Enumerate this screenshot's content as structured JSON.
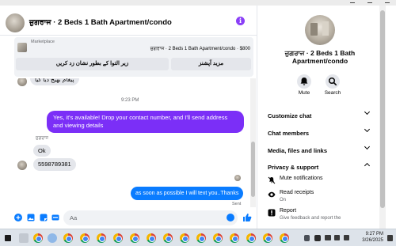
{
  "chat": {
    "title": "ਜ਼ੁਗਰਾਜ · 2 Beds 1 Bath Apartment/condo",
    "marketplace": {
      "label": "Marketplace",
      "listing": "ਜ਼ੁਗਰਾਜ · 2 Beds 1 Bath Apartment/condo · $800",
      "btn_more": "مزید آپشنز",
      "btn_mark": "زیر التوا کے بطور نشان زد کریں"
    },
    "messages": {
      "partial": "پیغام بھیج دیا گیا",
      "time_sep": "9:23 PM",
      "outgoing_1": "Yes, it's available! Drop your contact number, and I'll send address and viewing details",
      "sender_name": "ਜ਼ੁਗਰਾਜ",
      "incoming_ok": "Ok",
      "incoming_number": "5598789381",
      "outgoing_2": "as soon as possible I will text you..Thanks",
      "sent_status": "Sent"
    },
    "composer_placeholder": "Aa"
  },
  "info": {
    "title": "ਜ਼ੁਗਰਾਜ · 2 Beds 1 Bath Apartment/condo",
    "mute_label": "Mute",
    "search_label": "Search",
    "sections": {
      "customize": "Customize chat",
      "members": "Chat members",
      "media": "Media, files and links",
      "privacy": "Privacy & support"
    },
    "privacy_items": {
      "mute": "Mute notifications",
      "read_receipts": "Read receipts",
      "read_receipts_state": "On",
      "report": "Report",
      "report_desc": "Give feedback and report the"
    }
  },
  "taskbar": {
    "time": "9:27 PM",
    "date": "3/26/2025"
  },
  "colors": {
    "messenger_purple": "#7b2ff7",
    "messenger_blue": "#0a7cff",
    "bubble_grey": "#e4e6eb"
  }
}
